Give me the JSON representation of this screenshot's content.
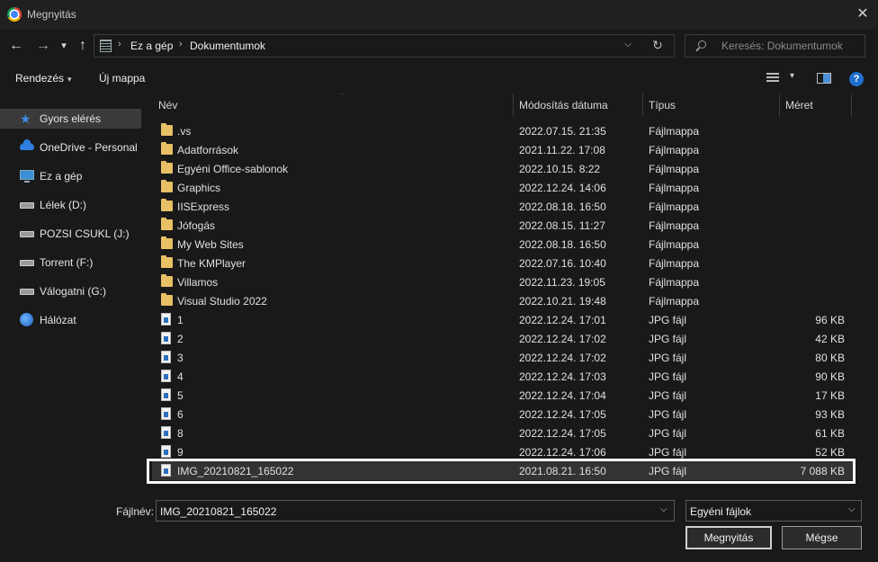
{
  "window": {
    "title": "Megnyitás",
    "close": "✕"
  },
  "nav": {
    "back": "←",
    "forward": "→",
    "recent": "▾",
    "up": "↑"
  },
  "address": {
    "sep1": "›",
    "crumb1": "Ez a gép",
    "sep2": "›",
    "crumb2": "Dokumentumok",
    "dropdown": "⌵",
    "refresh": "↻"
  },
  "search": {
    "placeholder": "Keresés: Dokumentumok"
  },
  "toolbar": {
    "organize": "Rendezés",
    "organize_caret": "▾",
    "new_folder": "Új mappa",
    "view_caret": "▾",
    "help": "?"
  },
  "sidebar": {
    "items": [
      {
        "label": "Gyors elérés",
        "icon": "star-icon"
      },
      {
        "label": "OneDrive - Personal",
        "icon": "cloud-icon"
      },
      {
        "label": "Ez a gép",
        "icon": "pc-icon"
      },
      {
        "label": "Lélek (D:)",
        "icon": "drive-icon"
      },
      {
        "label": "POZSI CSUKL (J:)",
        "icon": "drive-icon"
      },
      {
        "label": "Torrent (F:)",
        "icon": "drive-icon"
      },
      {
        "label": "Válogatni (G:)",
        "icon": "drive-icon"
      },
      {
        "label": "Hálózat",
        "icon": "network-icon"
      }
    ]
  },
  "columns": {
    "name": "Név",
    "modified": "Módosítás dátuma",
    "type": "Típus",
    "size": "Méret"
  },
  "files": [
    {
      "name": ".vs",
      "modified": "2022.07.15. 21:35",
      "type": "Fájlmappa",
      "size": "",
      "kind": "folder"
    },
    {
      "name": "Adatforrások",
      "modified": "2021.11.22. 17:08",
      "type": "Fájlmappa",
      "size": "",
      "kind": "folder"
    },
    {
      "name": "Egyéni Office-sablonok",
      "modified": "2022.10.15. 8:22",
      "type": "Fájlmappa",
      "size": "",
      "kind": "folder"
    },
    {
      "name": "Graphics",
      "modified": "2022.12.24. 14:06",
      "type": "Fájlmappa",
      "size": "",
      "kind": "folder"
    },
    {
      "name": "IISExpress",
      "modified": "2022.08.18. 16:50",
      "type": "Fájlmappa",
      "size": "",
      "kind": "folder"
    },
    {
      "name": "Jófogás",
      "modified": "2022.08.15. 11:27",
      "type": "Fájlmappa",
      "size": "",
      "kind": "folder"
    },
    {
      "name": "My Web Sites",
      "modified": "2022.08.18. 16:50",
      "type": "Fájlmappa",
      "size": "",
      "kind": "folder"
    },
    {
      "name": "The KMPlayer",
      "modified": "2022.07.16. 10:40",
      "type": "Fájlmappa",
      "size": "",
      "kind": "folder"
    },
    {
      "name": "Villamos",
      "modified": "2022.11.23. 19:05",
      "type": "Fájlmappa",
      "size": "",
      "kind": "folder"
    },
    {
      "name": "Visual Studio 2022",
      "modified": "2022.10.21. 19:48",
      "type": "Fájlmappa",
      "size": "",
      "kind": "folder"
    },
    {
      "name": "1",
      "modified": "2022.12.24. 17:01",
      "type": "JPG fájl",
      "size": "96 KB",
      "kind": "file"
    },
    {
      "name": "2",
      "modified": "2022.12.24. 17:02",
      "type": "JPG fájl",
      "size": "42 KB",
      "kind": "file"
    },
    {
      "name": "3",
      "modified": "2022.12.24. 17:02",
      "type": "JPG fájl",
      "size": "80 KB",
      "kind": "file"
    },
    {
      "name": "4",
      "modified": "2022.12.24. 17:03",
      "type": "JPG fájl",
      "size": "90 KB",
      "kind": "file"
    },
    {
      "name": "5",
      "modified": "2022.12.24. 17:04",
      "type": "JPG fájl",
      "size": "17 KB",
      "kind": "file"
    },
    {
      "name": "6",
      "modified": "2022.12.24. 17:05",
      "type": "JPG fájl",
      "size": "93 KB",
      "kind": "file"
    },
    {
      "name": "8",
      "modified": "2022.12.24. 17:05",
      "type": "JPG fájl",
      "size": "61 KB",
      "kind": "file"
    },
    {
      "name": "9",
      "modified": "2022.12.24. 17:06",
      "type": "JPG fájl",
      "size": "52 KB",
      "kind": "file"
    },
    {
      "name": "IMG_20210821_165022",
      "modified": "2021.08.21. 16:50",
      "type": "JPG fájl",
      "size": "7 088 KB",
      "kind": "file",
      "selected": true
    }
  ],
  "footer": {
    "filename_label": "Fájlnév:",
    "filename_value": "IMG_20210821_165022",
    "filter_value": "Egyéni fájlok",
    "open": "Megnyitás",
    "cancel": "Mégse",
    "dropdown": "⌵"
  }
}
